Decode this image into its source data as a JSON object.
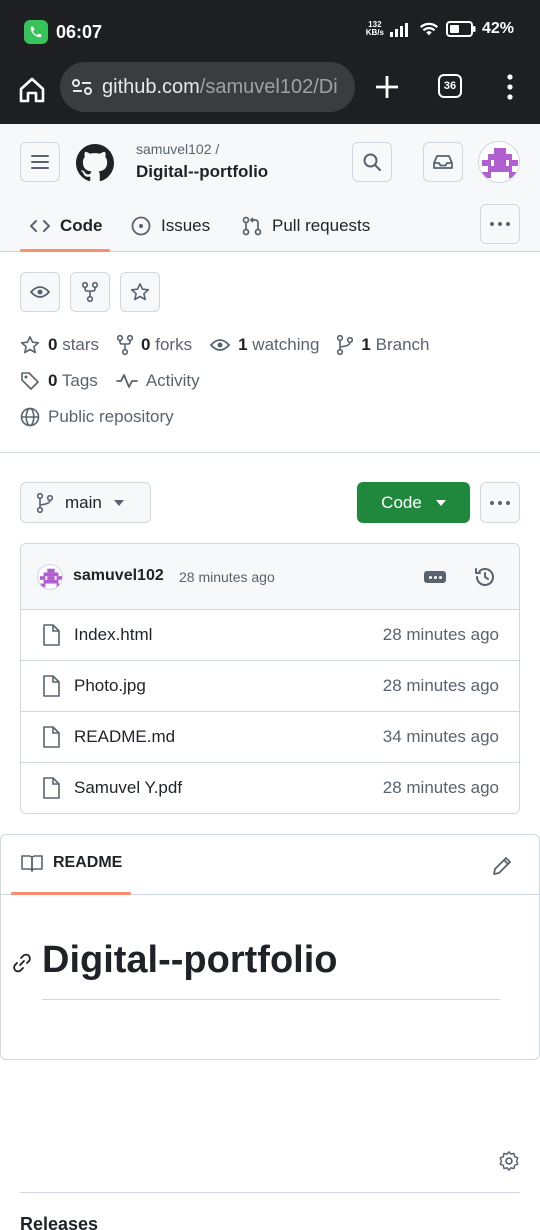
{
  "status_bar": {
    "time": "06:07",
    "net_speed_value": "132",
    "net_speed_unit": "KB/s",
    "battery_percent": "42%"
  },
  "browser": {
    "url_host": "github.com",
    "url_path": "/samuvel102/Di",
    "tab_count": "36"
  },
  "header": {
    "owner": "samuvel102 /",
    "repo": "Digital--portfolio"
  },
  "tabs": [
    {
      "label": "Code"
    },
    {
      "label": "Issues"
    },
    {
      "label": "Pull requests"
    }
  ],
  "stats": {
    "stars_count": "0",
    "stars_label": "stars",
    "forks_count": "0",
    "forks_label": "forks",
    "watching_count": "1",
    "watching_label": "watching",
    "branch_count": "1",
    "branch_label": "Branch",
    "tags_count": "0",
    "tags_label": "Tags",
    "activity_label": "Activity",
    "visibility": "Public repository"
  },
  "branch": {
    "name": "main",
    "code_label": "Code"
  },
  "latest_commit": {
    "user": "samuvel102",
    "time": "28 minutes ago"
  },
  "files": [
    {
      "name": "Index.html",
      "time": "28 minutes ago"
    },
    {
      "name": "Photo.jpg",
      "time": "28 minutes ago"
    },
    {
      "name": "README.md",
      "time": "34 minutes ago"
    },
    {
      "name": "Samuvel Y.pdf",
      "time": "28 minutes ago"
    }
  ],
  "readme": {
    "tab_label": "README",
    "heading": "Digital--portfolio"
  },
  "sidebar": {
    "releases_label": "Releases"
  },
  "colors": {
    "accent_green": "#1f883d",
    "tab_underline": "#fd8c73",
    "avatar_purple": "#b15fd0"
  }
}
